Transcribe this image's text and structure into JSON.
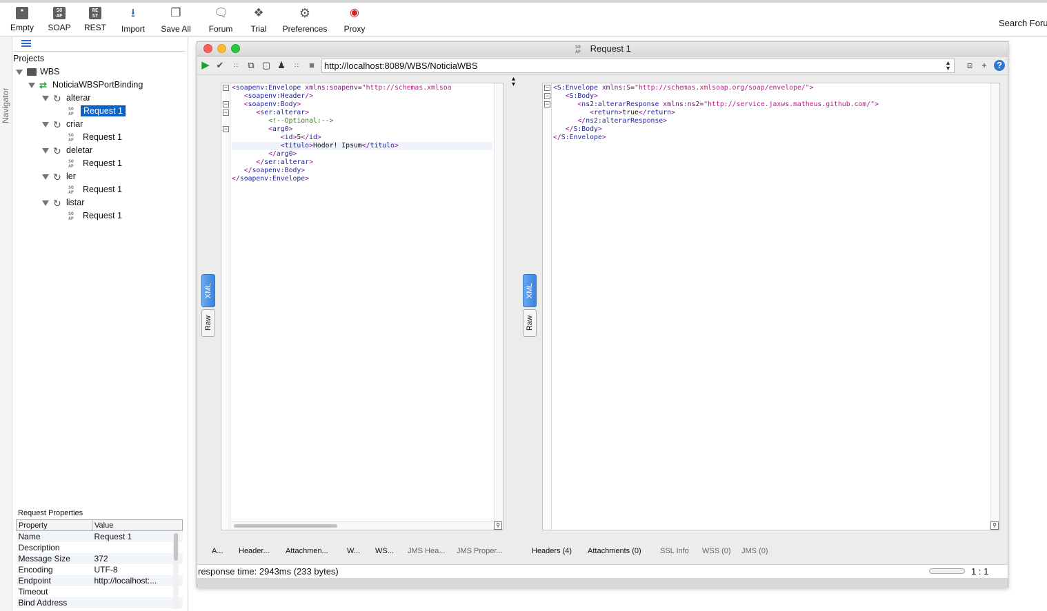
{
  "toolbar": {
    "items": [
      {
        "label": "Empty",
        "icon": "empty-project-icon"
      },
      {
        "label": "SOAP",
        "icon": "soap-project-icon"
      },
      {
        "label": "REST",
        "icon": "rest-project-icon"
      },
      {
        "label": "Import",
        "icon": "import-icon"
      },
      {
        "label": "Save All",
        "icon": "save-all-icon"
      },
      {
        "label": "Forum",
        "icon": "forum-icon"
      },
      {
        "label": "Trial",
        "icon": "trial-icon"
      },
      {
        "label": "Preferences",
        "icon": "gear-icon"
      },
      {
        "label": "Proxy",
        "icon": "proxy-icon"
      }
    ],
    "search_label": "Search Foru"
  },
  "navigator": {
    "strip_label": "Navigator",
    "root_label": "Projects",
    "project": "WBS",
    "binding": "NoticiaWBSPortBinding",
    "operations": [
      {
        "name": "alterar",
        "request": "Request 1"
      },
      {
        "name": "criar",
        "request": "Request 1"
      },
      {
        "name": "deletar",
        "request": "Request 1"
      },
      {
        "name": "ler",
        "request": "Request 1"
      },
      {
        "name": "listar",
        "request": "Request 1"
      }
    ]
  },
  "properties": {
    "title": "Request Properties",
    "headers": {
      "property": "Property",
      "value": "Value"
    },
    "rows": [
      {
        "property": "Name",
        "value": "Request 1"
      },
      {
        "property": "Description",
        "value": ""
      },
      {
        "property": "Message Size",
        "value": "372"
      },
      {
        "property": "Encoding",
        "value": "UTF-8"
      },
      {
        "property": "Endpoint",
        "value": "http://localhost:..."
      },
      {
        "property": "Timeout",
        "value": ""
      },
      {
        "property": "Bind Address",
        "value": ""
      }
    ]
  },
  "request_window": {
    "title": "Request 1",
    "endpoint_url": "http://localhost:8089/WBS/NoticiaWBS",
    "request_tabs": {
      "xml": "XML",
      "raw": "Raw"
    },
    "response_tabs": {
      "xml": "XML",
      "raw": "Raw"
    },
    "request_bottom_tabs": [
      "A...",
      "Header...",
      "Attachmen...",
      "W...",
      "WS...",
      "JMS Hea...",
      "JMS Proper..."
    ],
    "response_bottom_tabs": [
      "Headers (4)",
      "Attachments (0)",
      "SSL Info",
      "WSS (0)",
      "JMS (0)"
    ],
    "status_text": "response time: 2943ms (233 bytes)",
    "cursor_position": "1 : 1"
  },
  "request_xml": {
    "lines": [
      {
        "open1": "<",
        "tag1": "soapenv:Envelope",
        "attr1": " xmlns:soapenv",
        "eq1": "=",
        "val1": "\"http://schemas.xmlsoa",
        "close1": "",
        "text1": "",
        "indent": 0
      },
      {
        "open1": "<",
        "tag1": "soapenv:Header",
        "attr1": "",
        "eq1": "",
        "val1": "",
        "close1": "/>",
        "text1": "",
        "indent": 1
      },
      {
        "open1": "<",
        "tag1": "soapenv:Body",
        "attr1": "",
        "eq1": "",
        "val1": "",
        "close1": ">",
        "text1": "",
        "indent": 1
      },
      {
        "open1": "<",
        "tag1": "ser:alterar",
        "attr1": "",
        "eq1": "",
        "val1": "",
        "close1": ">",
        "text1": "",
        "indent": 2
      },
      {
        "comment": "<!--Optional:-->",
        "indent": 3
      },
      {
        "open1": "<",
        "tag1": "arg0",
        "attr1": "",
        "eq1": "",
        "val1": "",
        "close1": ">",
        "text1": "",
        "indent": 3
      },
      {
        "open1": "<",
        "tag1": "id",
        "attr1": "",
        "eq1": "",
        "val1": "",
        "close1": ">",
        "text1": "5",
        "endtag": "id",
        "indent": 4
      },
      {
        "open1": "<",
        "tag1": "titulo",
        "attr1": "",
        "eq1": "",
        "val1": "",
        "close1": ">",
        "text1": "Hodor! Ipsum",
        "endtag": "titulo",
        "indent": 4
      },
      {
        "endonly": "arg0",
        "indent": 3
      },
      {
        "endonly": "ser:alterar",
        "indent": 2
      },
      {
        "endonly": "soapenv:Body",
        "indent": 1
      },
      {
        "endonly": "soapenv:Envelope",
        "indent": 0
      }
    ]
  },
  "response_xml": {
    "lines": [
      {
        "open1": "<",
        "tag1": "S:Envelope",
        "attr1": " xmlns:S",
        "eq1": "=",
        "val1": "\"http://schemas.xmlsoap.org/soap/envelope/\"",
        "close1": ">",
        "text1": "",
        "indent": 0
      },
      {
        "open1": "<",
        "tag1": "S:Body",
        "attr1": "",
        "eq1": "",
        "val1": "",
        "close1": ">",
        "text1": "",
        "indent": 1
      },
      {
        "open1": "<",
        "tag1": "ns2:alterarResponse",
        "attr1": " xmlns:ns2",
        "eq1": "=",
        "val1": "\"http://service.jaxws.matheus.github.com/\"",
        "close1": ">",
        "text1": "",
        "indent": 2
      },
      {
        "open1": "<",
        "tag1": "return",
        "attr1": "",
        "eq1": "",
        "val1": "",
        "close1": ">",
        "text1": "true",
        "endtag": "return",
        "indent": 3
      },
      {
        "endonly": "ns2:alterarResponse",
        "indent": 2
      },
      {
        "endonly": "S:Body",
        "indent": 1
      },
      {
        "endonly": "S:Envelope",
        "indent": 0
      }
    ]
  },
  "colors": {
    "accent": "#0b63ce",
    "xml_tag": "#9a0a9a",
    "xml_value": "#c4168a",
    "xml_comment": "#267f12"
  }
}
